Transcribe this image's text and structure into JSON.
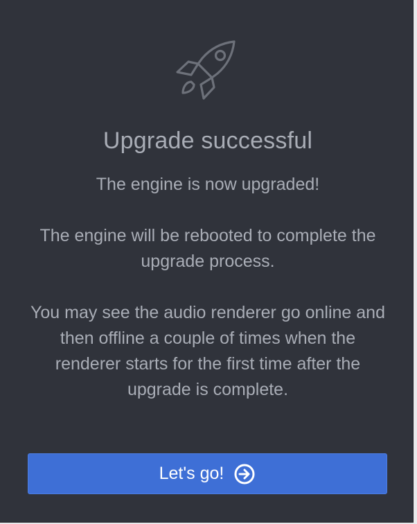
{
  "dialog": {
    "icon": "rocket-icon",
    "title": "Upgrade successful",
    "messages": [
      "The engine is now upgraded!",
      "The engine will be rebooted to complete the upgrade process.",
      "You may see the audio renderer go online and then offline a couple of times when the renderer starts for the first time after the upgrade is complete."
    ],
    "button": {
      "label": "Let's go!",
      "icon": "arrow-right-circle-icon"
    }
  },
  "colors": {
    "background": "#30333b",
    "text": "#a9adb6",
    "button": "#3e6fd6",
    "button_text": "#ffffff"
  }
}
